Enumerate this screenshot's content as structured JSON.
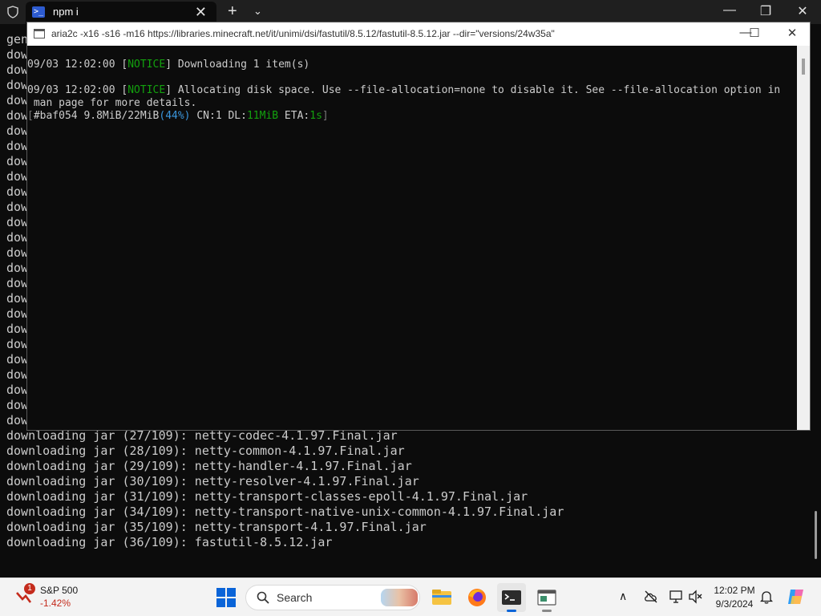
{
  "wt": {
    "tab_title": "npm i",
    "close_glyph": "✕",
    "new_tab_glyph": "+",
    "dropdown_glyph": "⌄",
    "minimize_glyph": "—",
    "restore_glyph": "❐",
    "window_close_glyph": "✕",
    "background_lines": [
      "gen",
      "dow",
      "dow",
      "dow",
      "dow",
      "dow",
      "dow",
      "dow",
      "dow",
      "dow",
      "dow",
      "dow",
      "dow",
      "dow",
      "dow",
      "dow",
      "dow",
      "dow",
      "dow",
      "dow",
      "dow",
      "dow",
      "dow",
      "dow",
      "dow",
      "dow",
      "downloading jar (27/109): netty-codec-4.1.97.Final.jar",
      "downloading jar (28/109): netty-common-4.1.97.Final.jar",
      "downloading jar (29/109): netty-handler-4.1.97.Final.jar",
      "downloading jar (30/109): netty-resolver-4.1.97.Final.jar",
      "downloading jar (31/109): netty-transport-classes-epoll-4.1.97.Final.jar",
      "downloading jar (34/109): netty-transport-native-unix-common-4.1.97.Final.jar",
      "downloading jar (35/109): netty-transport-4.1.97.Final.jar",
      "downloading jar (36/109): fastutil-8.5.12.jar"
    ]
  },
  "aria": {
    "title": "aria2c  -x16 -s16 -m16 https://libraries.minecraft.net/it/unimi/dsi/fastutil/8.5.12/fastutil-8.5.12.jar --dir=\"versions/24w35a\"",
    "minimize_glyph": "—",
    "maximize_glyph": "☐",
    "close_glyph": "✕",
    "line1_prefix": "09/03 12:02:00 [",
    "notice": "NOTICE",
    "line1_suffix": "] Downloading 1 item(s)",
    "line2_suffix": "] Allocating disk space. Use --file-allocation=none to disable it. See --file-allocation option in",
    "line3": " man page for more details.",
    "progress": {
      "open_bracket": "[",
      "id_size": "#baf054 9.8MiB/22MiB",
      "percent": "(44%)",
      "cn_dl_label": " CN:1 DL:",
      "speed": "11MiB",
      "eta_label": " ETA:",
      "eta": "1s",
      "close_bracket": "]"
    }
  },
  "taskbar": {
    "stock_badge": "1",
    "stock_name": "S&P 500",
    "stock_change": "-1.42%",
    "search_label": "Search",
    "tray_chevron": "∧",
    "clock_time": "12:02 PM",
    "clock_date": "9/3/2024",
    "colors": {
      "windows_blue": "#0a64d8",
      "stock_red": "#c42b1c",
      "notice_green": "#13a10e",
      "percent_blue": "#3a96dd"
    }
  }
}
